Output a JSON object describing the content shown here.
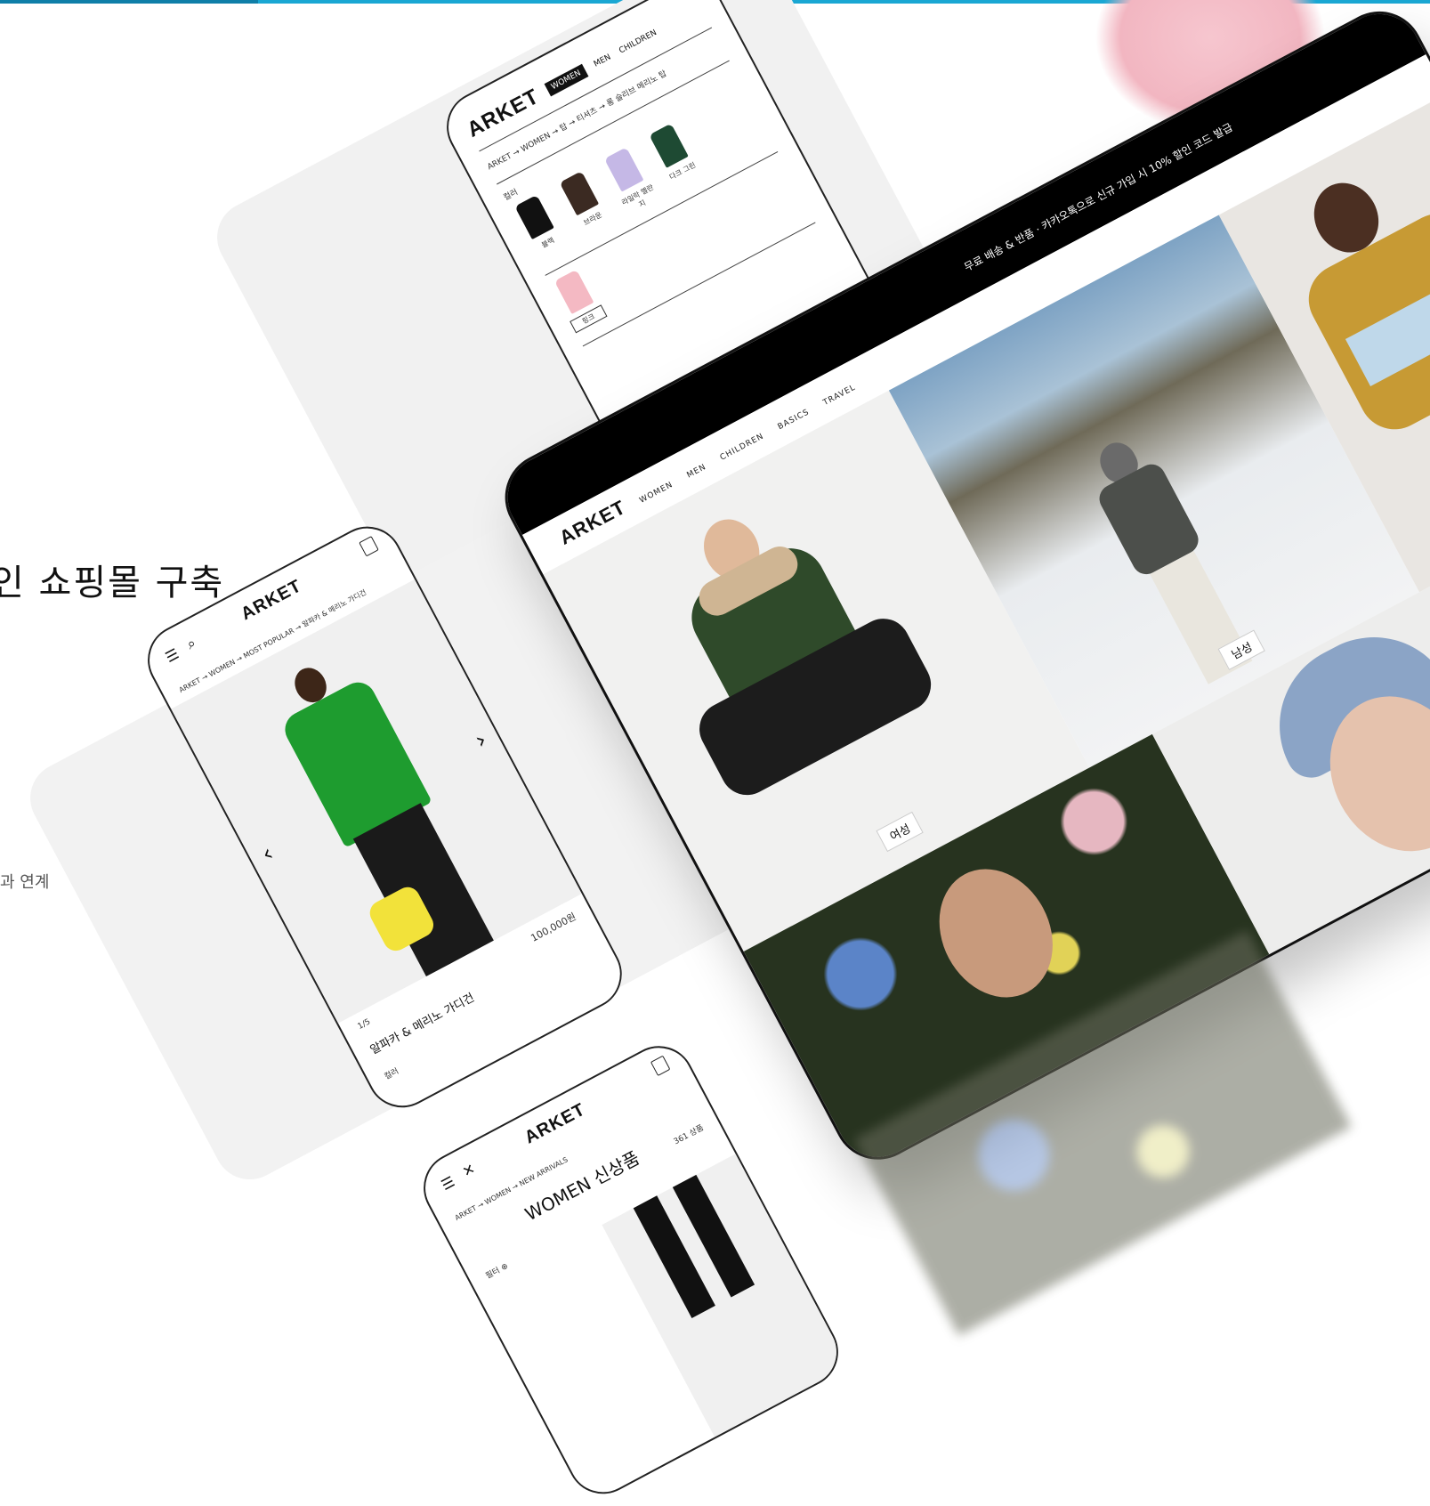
{
  "page": {
    "headline": "인 쇼핑몰 구축",
    "subtext": "과 연계"
  },
  "colors": {
    "accent": "#1aa7d3",
    "panel": "#f2f2f2",
    "cardigan": "#1e9c2f",
    "bag": "#f2e23a"
  },
  "product_phone": {
    "logo": "ARKET",
    "nav_tabs": [
      "WOMEN",
      "MEN",
      "CHILDREN"
    ],
    "breadcrumb": "ARKET → WOMEN → 탑 → 티셔츠 → 롱 슬리브 메리노 탑",
    "color_label": "컬러",
    "swatches": [
      {
        "label": "블랙",
        "color": "#111111"
      },
      {
        "label": "브라운",
        "color": "#3b2a22"
      },
      {
        "label": "라일락 멜란지",
        "color": "#c5b8e6"
      },
      {
        "label": "다크 그린",
        "color": "#1e4a33"
      },
      {
        "label": "핑크",
        "color": "#f4b9c3"
      }
    ],
    "selected_color": "핑크"
  },
  "cardigan_phone": {
    "logo": "ARKET",
    "breadcrumb": "ARKET → WOMEN → MOST POPULAR → 알파카 & 메리노 가디건",
    "price": "100,000원",
    "pager": "1/5",
    "product_name": "알파카 & 메리노 가디건",
    "color_label": "컬러",
    "prev": "‹",
    "next": "›"
  },
  "newarrivals_phone": {
    "logo": "ARKET",
    "breadcrumb": "ARKET → WOMEN → NEW ARRIVALS",
    "title": "WOMEN 신상품",
    "count": "361 상품",
    "filter": "필터 ⊕"
  },
  "tablet": {
    "banner": "무료 배송 & 반품 · 카카오톡으로 신규 가입 시 10% 할인 코드 발급",
    "logo": "ARKET",
    "nav": [
      "WOMEN",
      "MEN",
      "CHILDREN",
      "BASICS",
      "TRAVEL"
    ],
    "tiles": [
      {
        "caption": "여성"
      },
      {
        "caption": "남성"
      },
      {
        "caption": ""
      },
      {
        "caption": ""
      },
      {
        "caption": ""
      }
    ]
  }
}
